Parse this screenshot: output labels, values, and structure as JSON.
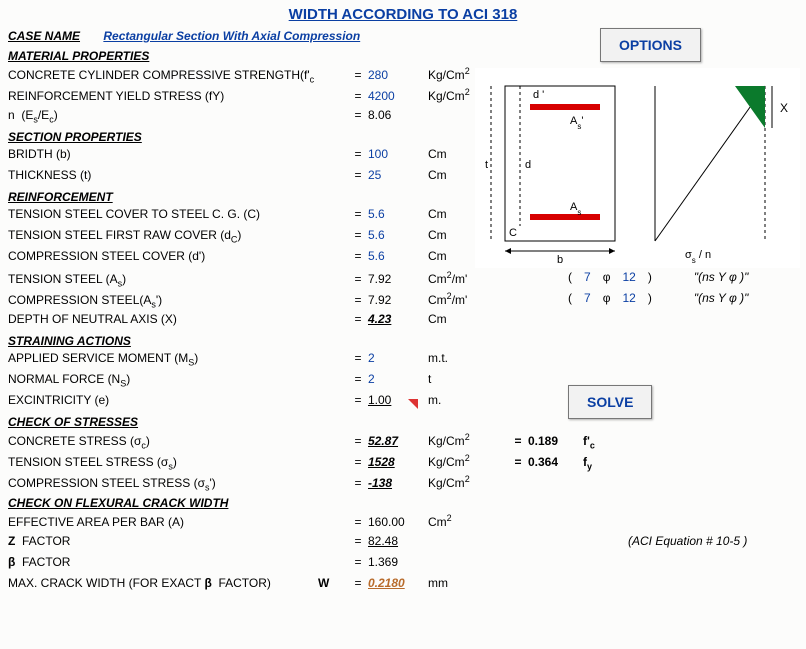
{
  "title": "WIDTH ACCORDING TO ACI 318",
  "case_label": "CASE NAME",
  "case_value": "Rectangular Section With Axial Compression",
  "buttons": {
    "options": "OPTIONS",
    "solve": "SOLVE"
  },
  "sections": {
    "matprop": "MATERIAL PROPERTIES",
    "sectprop": "SECTION PROPERTIES",
    "reinf": "REINFORCEMENT",
    "strain": "STRAINING ACTIONS",
    "checkstress": "CHECK OF STRESSES",
    "crack": "CHECK ON  FLEXURAL CRACK WIDTH"
  },
  "rows": {
    "fc": {
      "lbl": "CONCRETE CYLINDER COMPRESSIVE STRENGTH(f'c)",
      "val": "280",
      "unit": "Kg/Cm²"
    },
    "fy": {
      "lbl": "REINFORCEMENT YIELD STRESS (fY)",
      "val": "4200",
      "unit": "Kg/Cm²"
    },
    "n": {
      "lbl": "n  (Es/Ec)",
      "val": "8.06",
      "unit": ""
    },
    "b": {
      "lbl": "BRIDTH (b)",
      "val": "100",
      "unit": "Cm"
    },
    "t": {
      "lbl": "THICKNESS (t)",
      "val": "25",
      "unit": "Cm"
    },
    "cc": {
      "lbl": "TENSION STEEL COVER TO STEEL C. G. (C)",
      "val": "5.6",
      "unit": "Cm"
    },
    "dc": {
      "lbl": "TENSION STEEL FIRST RAW COVER (dC)",
      "val": "5.6",
      "unit": "Cm"
    },
    "dpr": {
      "lbl": "COMPRESSION STEEL COVER (d')",
      "val": "5.6",
      "unit": "Cm"
    },
    "as": {
      "lbl": "TENSION STEEL (As)",
      "val": "7.92",
      "unit": "Cm²/m'"
    },
    "asp": {
      "lbl": "COMPRESSION STEEL(As')",
      "val": "7.92",
      "unit": "Cm²/m'"
    },
    "x": {
      "lbl": "DEPTH OF NEUTRAL AXIS (X)",
      "val": "4.23",
      "unit": "Cm"
    },
    "ms": {
      "lbl": "APPLIED SERVICE MOMENT (MS)",
      "val": "2",
      "unit": "m.t."
    },
    "ns": {
      "lbl": "NORMAL FORCE (NS)",
      "val": "2",
      "unit": "t"
    },
    "ex": {
      "lbl": "EXCINTRICITY (e)",
      "val": "1.00",
      "unit": "m."
    },
    "sigc": {
      "lbl": "CONCRETE STRESS (σc)",
      "val": "52.87",
      "unit": "Kg/Cm²",
      "ratio": "0.189",
      "sym": "f'c"
    },
    "sigs": {
      "lbl": "TENSION STEEL STRESS (σs)",
      "val": "1528",
      "unit": "Kg/Cm²",
      "ratio": "0.364",
      "sym": "fy"
    },
    "sigsp": {
      "lbl": "COMPRESSION STEEL STRESS (σs')",
      "val": "-138",
      "unit": "Kg/Cm²"
    },
    "area": {
      "lbl": "EFFECTIVE AREA PER BAR (A)",
      "val": "160.00",
      "unit": "Cm²"
    },
    "z": {
      "lbl": "Z  FACTOR",
      "val": "82.48",
      "unit": "",
      "note": "(ACI  Equation # 10-5 )"
    },
    "beta": {
      "lbl": "β  FACTOR",
      "val": "1.369",
      "unit": ""
    },
    "mcw": {
      "lbl": "MAX. CRACK WIDTH (FOR EXACT β  FACTOR)",
      "wlbl": "W",
      "val": "0.2180",
      "unit": "mm"
    }
  },
  "phi": {
    "as": {
      "n": "7",
      "dia": "12",
      "note": "\"(ns  Y  φ   )\""
    },
    "asp": {
      "n": "7",
      "dia": "12",
      "note": "\"(ns  Y  φ   )\""
    }
  },
  "icons": {
    "phi": "φ"
  },
  "diagram_labels": {
    "d": "d",
    "dpr": "d '",
    "t": "t",
    "c": "C",
    "b": "b",
    "Asprime": "A s'",
    "As": "A s",
    "X": "X",
    "sigma": "σ s / n"
  }
}
